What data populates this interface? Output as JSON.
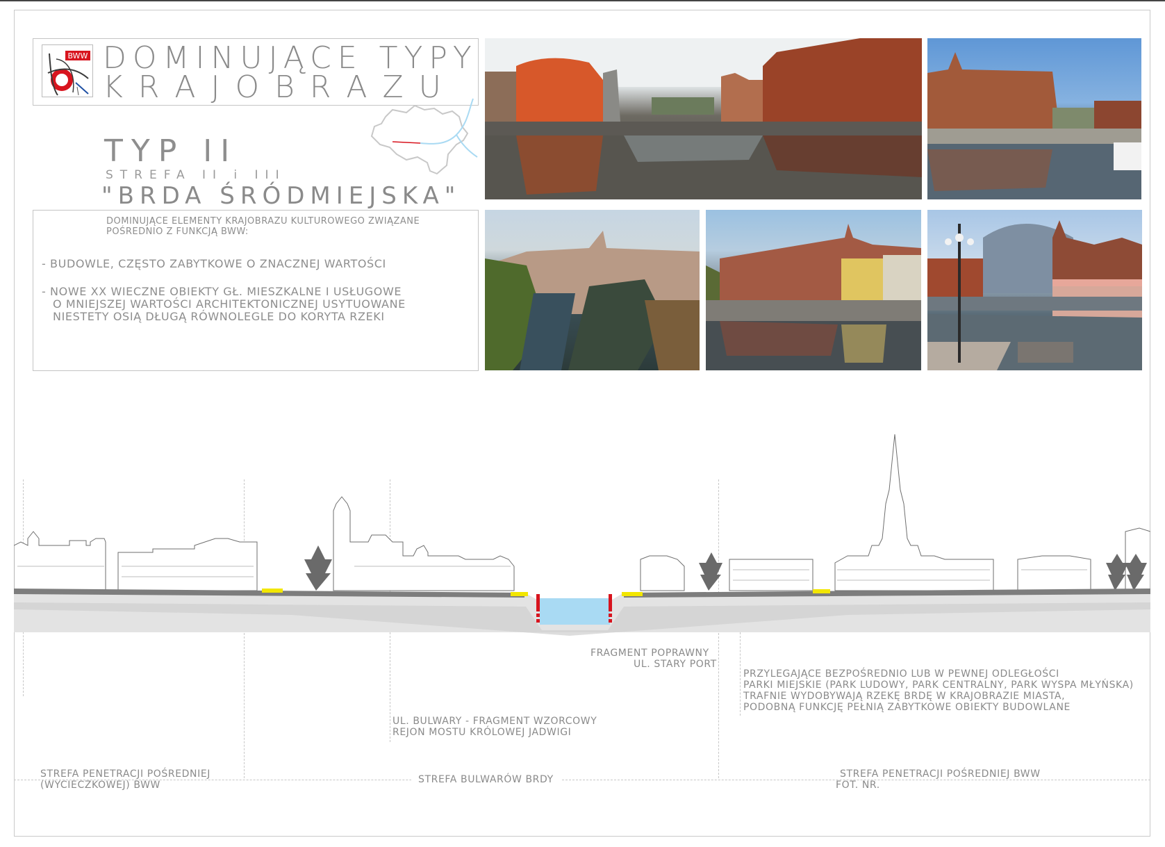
{
  "header": {
    "title_line1": "DOMINUJĄCE TYPY",
    "title_line2": "K R A J O B R A Z U",
    "logo_text": "BWW"
  },
  "type": {
    "title": "TYP II",
    "zone": "STREFA II i III",
    "name": "\"BRDA ŚRÓDMIEJSKA\""
  },
  "description": {
    "intro": "DOMINUJĄCE ELEMENTY KRAJOBRAZU KULTUROWEGO ZWIĄZANE POŚREDNIO Z FUNKCJĄ BWW:",
    "bullet1": "-  BUDOWLE, CZĘSTO ZABYTKOWE O ZNACZNEJ WARTOŚCI",
    "bullet2_line1": "-  NOWE XX WIECZNE OBIEKTY GŁ. MIESZKALNE I USŁUGOWE",
    "bullet2_line2": "O MNIEJSZEJ WARTOŚCI ARCHITEKTONICZNEJ USYTUOWANE",
    "bullet2_line3": "NIESTETY OSIĄ DŁUGĄ RÓWNOLEGLE DO KORYTA RZEKI"
  },
  "annotations": {
    "fragment_line1": "FRAGMENT POPRAWNY",
    "fragment_line2": "UL. STARY PORT",
    "parks_line1": "PRZYLEGAJĄCE BEZPOŚREDNIO LUB W PEWNEJ ODLEGŁOŚCI",
    "parks_line2": "PARKI MIEJSKIE (PARK LUDOWY, PARK CENTRALNY, PARK WYSPA MŁYŃSKA)",
    "parks_line3": "TRAFNIE WYDOBYWAJĄ RZEKĘ BRDĘ W KRAJOBRAZIE MIASTA,",
    "parks_line4": "PODOBNĄ FUNKCJĘ PEŁNIĄ ZABYTKOWE OBIEKTY BUDOWLANE",
    "bulwary_line1": "UL. BULWARY - FRAGMENT WZORCOWY",
    "bulwary_line2": "REJON MOSTU KRÓLOWEJ JADWIGI"
  },
  "zones": {
    "left_line1": "STREFA PENETRACJI POŚREDNIEJ",
    "left_line2": "(WYCIECZKOWEJ) BWW",
    "middle": "STREFA BULWARÓW BRDY",
    "right_line1": "STREFA PENETRACJI POŚREDNIEJ BWW",
    "right_line2": "FOT. NR."
  },
  "colors": {
    "water": "#a9daf3",
    "path_yellow": "#f2e600",
    "marker_red": "#d8141e",
    "ground": "#dcdcdc",
    "ground_dark": "#7d7d7d"
  }
}
